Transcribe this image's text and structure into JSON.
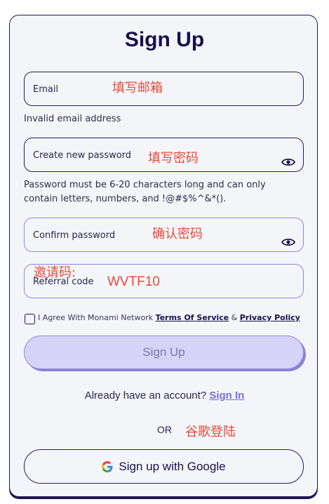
{
  "form": {
    "title": "Sign Up",
    "email": {
      "label": "Email",
      "annotation": "填写邮箱",
      "error": "Invalid email address"
    },
    "password": {
      "label": "Create new password",
      "annotation": "填写密码",
      "hint_line1": "Password must be 6-20 characters long and can only",
      "hint_line2": "contain letters, numbers, and !@#$%^&*().",
      "icon": "eye-icon"
    },
    "confirm": {
      "label": "Confirm password",
      "annotation": "确认密码",
      "icon": "eye-icon"
    },
    "referral": {
      "label": "Referral code",
      "annotation_label": "邀请码:",
      "value": "WVTF10"
    },
    "agreement": {
      "prefix": "I Agree With Monami Network",
      "terms": "Terms Of Service",
      "and": "&",
      "privacy": "Privacy Policy"
    },
    "submit_label": "Sign Up",
    "signin": {
      "prompt": "Already have an account?",
      "link": "Sign In"
    },
    "or_label": "OR",
    "or_annotation": "谷歌登陆",
    "google_label": "Sign up with Google"
  },
  "colors": {
    "primary": "#1a0f4d",
    "accent": "#7a6ee0",
    "annotation": "#e64b3c",
    "button_disabled_bg": "#d7d3f7"
  }
}
